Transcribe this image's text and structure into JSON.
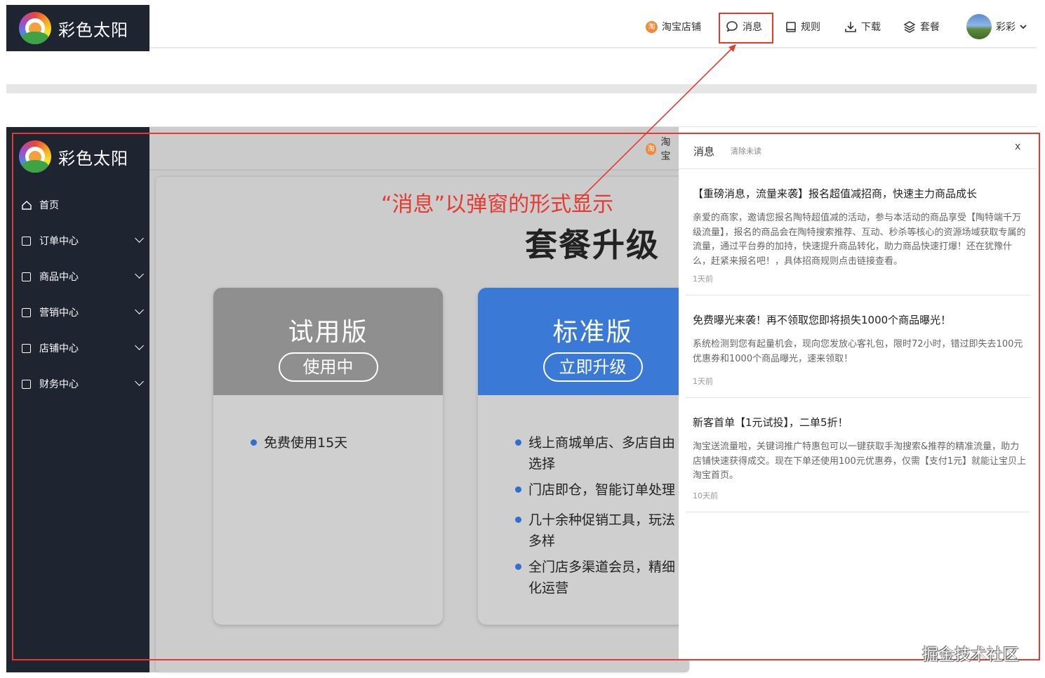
{
  "brand": {
    "name": "彩色太阳"
  },
  "top_nav": {
    "shop": "淘宝店铺",
    "shop_badge": "淘",
    "messages": "消息",
    "rules": "规则",
    "download": "下载",
    "package": "套餐",
    "user": "彩彩"
  },
  "content_header": {
    "shop_partial": "淘宝",
    "shop_badge": "淘"
  },
  "sidebar": {
    "items": [
      {
        "label": "首页"
      },
      {
        "label": "订单中心"
      },
      {
        "label": "商品中心"
      },
      {
        "label": "营销中心"
      },
      {
        "label": "店铺中心"
      },
      {
        "label": "财务中心"
      }
    ]
  },
  "annotation": "“消息”以弹窗的形式显示",
  "page": {
    "title": "套餐升级"
  },
  "plans": [
    {
      "name": "试用版",
      "button": "使用中",
      "features": [
        "免费使用15天"
      ],
      "color": "#8f8f8f"
    },
    {
      "name": "标准版",
      "button": "立即升级",
      "features": [
        "线上商城单店、多店自由选择",
        "门店即仓，智能订单处理",
        "几十余种促销工具，玩法多样",
        "全门店多渠道会员，精细化运营"
      ],
      "color": "#3a7ad6"
    }
  ],
  "popup": {
    "title": "消息",
    "clear": "清除未读",
    "close": "x",
    "messages": [
      {
        "title": "【重磅消息，流量来袭】报名超值减招商，快速主力商品成长",
        "body": "亲爱的商家，邀请您报名陶特超值减的活动，参与本活动的商品享受【陶特端千万级流量】，报名的商品会在陶特搜索推荐、互动、秒杀等核心的资源场域获取专属的流量，通过平台券的加持，快速提升商品转化，助力商品快速打爆！还在犹豫什么，赶紧来报名吧！，具体招商规则点击链接查看。",
        "time": "1天前"
      },
      {
        "title": "免费曝光来袭！再不领取您即将损失1000个商品曝光！",
        "body": "系统检测到您有起量机会，现向您发放心客礼包，限时72小时，错过即失去100元优惠券和1000个商品曝光，速来领取！",
        "time": "1天前"
      },
      {
        "title": "新客首单【1元试投】，二单5折！",
        "body": "淘宝送流量啦，关键词推广特惠包可以一键获取手淘搜索&推荐的精准流量，助力店铺快速获得成交。现在下单还使用100元优惠券，仅需【支付1元】就能让宝贝上淘宝首页。",
        "time": "10天前"
      }
    ]
  },
  "watermark": "掘金技术社区",
  "colors": {
    "sidebar": "#1f2431",
    "annotation": "#e43a2f",
    "plan_blue": "#3a7ad6",
    "plan_gray": "#8f8f8f"
  }
}
